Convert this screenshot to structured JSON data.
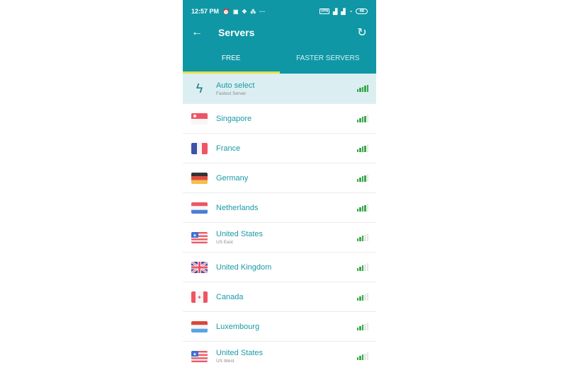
{
  "status_bar": {
    "time": "12:57 PM",
    "left_icons": [
      "alarm-icon",
      "message-icon",
      "app-icon",
      "share-icon"
    ],
    "more": "···",
    "vpn": "VPN",
    "battery": "48"
  },
  "toolbar": {
    "back_icon": "←",
    "title": "Servers",
    "refresh_icon": "↻"
  },
  "tabs": [
    {
      "label": "FREE",
      "active": true
    },
    {
      "label": "FASTER SERVERS",
      "active": false
    }
  ],
  "colors": {
    "primary": "#0f97a5",
    "tab_indicator": "#e3e04a",
    "selected_row": "#dbeff2",
    "signal_on": "#3aa84a",
    "name_text": "#1a9aa6"
  },
  "servers": [
    {
      "name": "Auto select",
      "subtitle": "Fastest Server",
      "flag": "bolt",
      "signal": 5,
      "selected": true
    },
    {
      "name": "Singapore",
      "subtitle": "",
      "flag": "sg",
      "signal": 4
    },
    {
      "name": "France",
      "subtitle": "",
      "flag": "fr",
      "signal": 4
    },
    {
      "name": "Germany",
      "subtitle": "",
      "flag": "de",
      "signal": 4
    },
    {
      "name": "Netherlands",
      "subtitle": "",
      "flag": "nl",
      "signal": 4
    },
    {
      "name": "United States",
      "subtitle": "US East",
      "flag": "us",
      "signal": 3
    },
    {
      "name": "United Kingdom",
      "subtitle": "",
      "flag": "gb",
      "signal": 3
    },
    {
      "name": "Canada",
      "subtitle": "",
      "flag": "ca",
      "signal": 3
    },
    {
      "name": "Luxembourg",
      "subtitle": "",
      "flag": "lu",
      "signal": 3
    },
    {
      "name": "United States",
      "subtitle": "US West",
      "flag": "us",
      "signal": 3
    }
  ]
}
